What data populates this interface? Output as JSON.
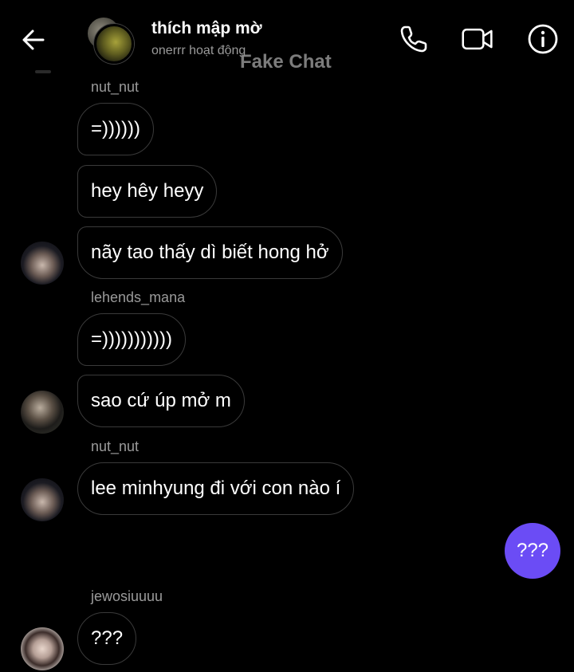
{
  "header": {
    "title": "thích mập mờ",
    "subtitle": "onerrr hoạt động",
    "watermark": "Fake Chat",
    "icons": [
      "back-arrow-icon",
      "phone-icon",
      "video-camera-icon",
      "info-icon"
    ]
  },
  "messages": {
    "g1": {
      "sender": "nut_nut",
      "b1": "=))))))",
      "b2": "hey hêy heyy",
      "b3": "nãy tao thấy dì biết hong hở"
    },
    "g2": {
      "sender": "lehends_mana",
      "b1": "=)))))))))))",
      "b2": "sao cứ úp mở m"
    },
    "g3": {
      "sender": "nut_nut",
      "b1": "lee minhyung đi với con nào í"
    },
    "mine": {
      "b1": "???"
    },
    "g4": {
      "sender": "jewosiuuuu",
      "b1": "???"
    }
  },
  "colors": {
    "background": "#000000",
    "my_bubble": "#6b4cf5",
    "bubble_border": "#3a3a3a",
    "secondary_text": "#9a9a9a"
  }
}
